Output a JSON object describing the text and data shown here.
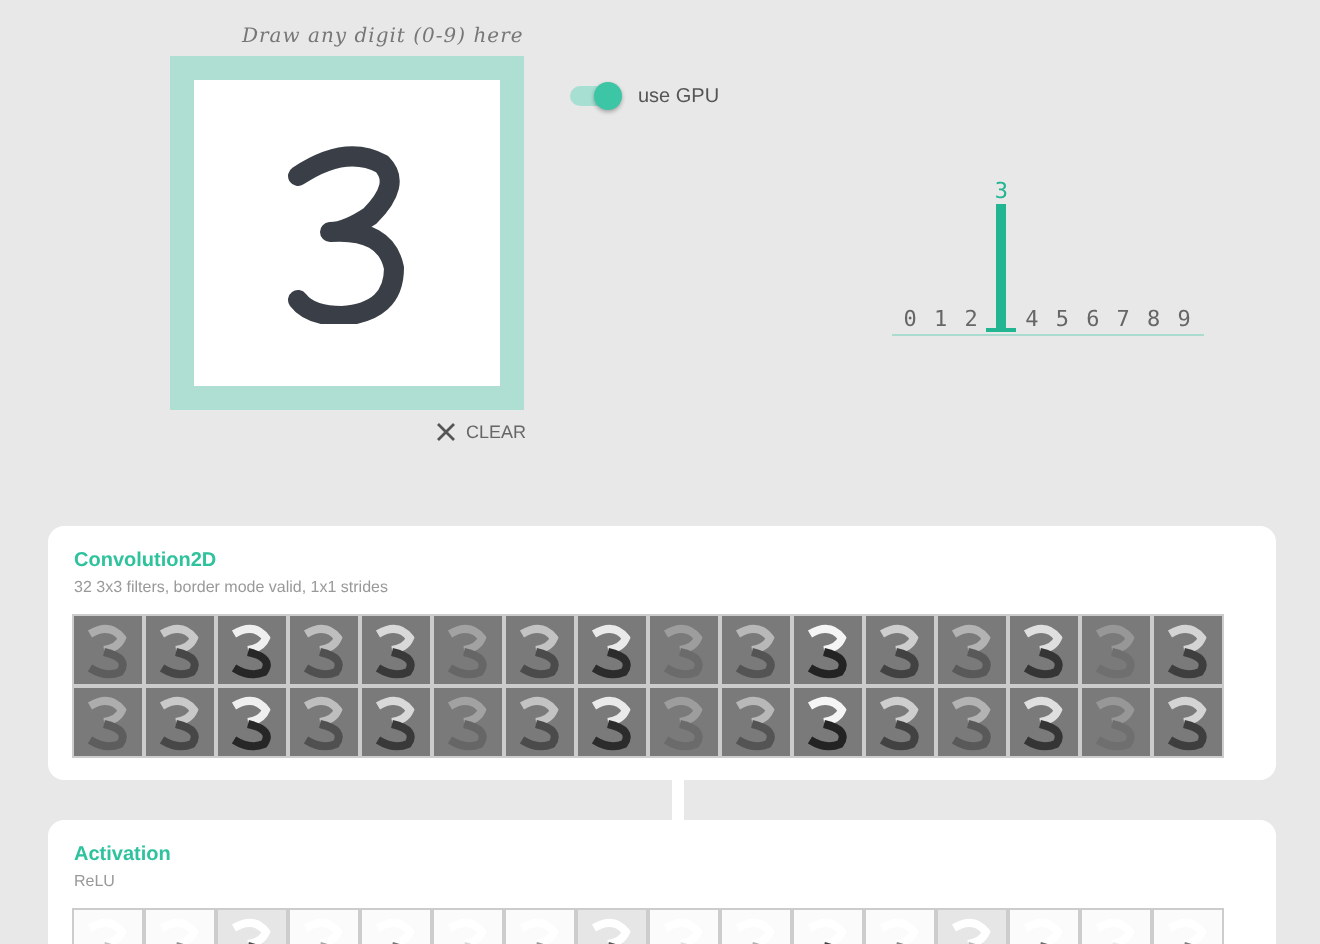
{
  "hint": "Draw any digit (0-9) here",
  "clear_button": "CLEAR",
  "gpu_toggle": {
    "label": "use GPU",
    "on": true
  },
  "predictions": [
    {
      "label": "0",
      "selected": false
    },
    {
      "label": "1",
      "selected": false
    },
    {
      "label": "2",
      "selected": false
    },
    {
      "label": "3",
      "selected": true
    },
    {
      "label": "4",
      "selected": false
    },
    {
      "label": "5",
      "selected": false
    },
    {
      "label": "6",
      "selected": false
    },
    {
      "label": "7",
      "selected": false
    },
    {
      "label": "8",
      "selected": false
    },
    {
      "label": "9",
      "selected": false
    }
  ],
  "layers": [
    {
      "title": "Convolution2D",
      "subtitle": "32 3x3 filters, border mode valid, 1x1 strides",
      "kind": "conv"
    },
    {
      "title": "Activation",
      "subtitle": "ReLU",
      "kind": "relu"
    }
  ]
}
